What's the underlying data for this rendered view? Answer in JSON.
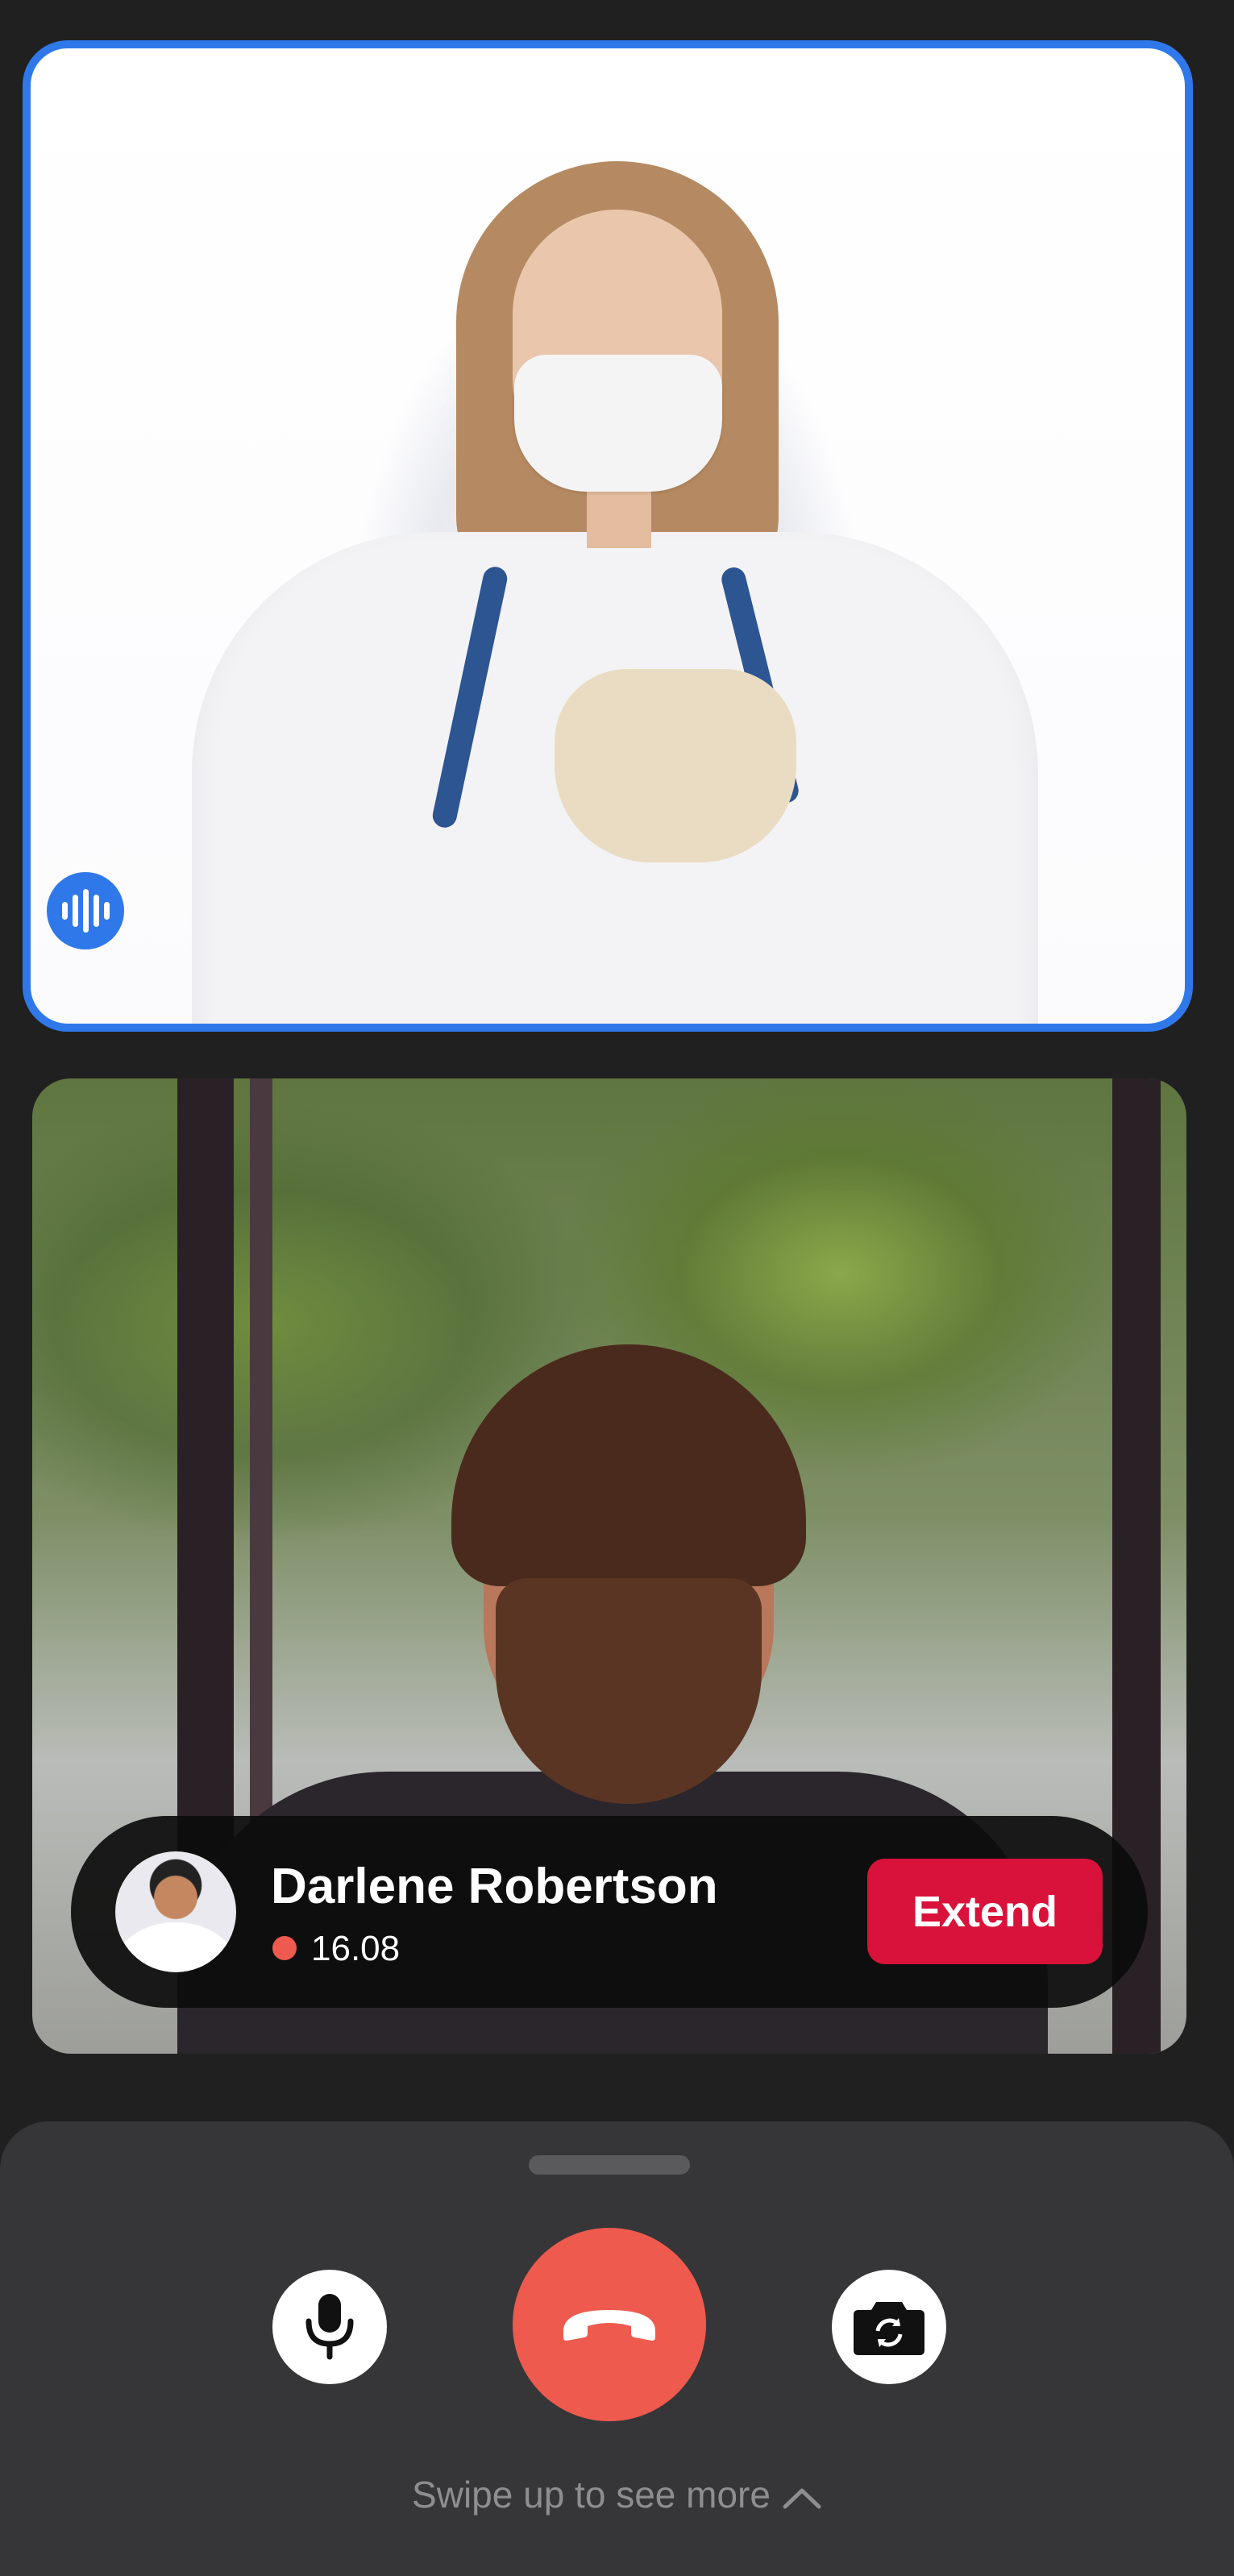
{
  "caller": {
    "name": "Darlene Robertson",
    "duration": "16.08"
  },
  "actions": {
    "extend_label": "Extend"
  },
  "sheet": {
    "swipe_hint": "Swipe up to see more"
  },
  "colors": {
    "active_speaker_border": "#2f78ea",
    "end_call": "#ef5a4e",
    "extend_button": "#d8123a",
    "recording_dot": "#ee5a4e"
  },
  "icons": {
    "voice_activity": "audio-wave-icon",
    "mic": "microphone-icon",
    "end_call": "phone-hangup-icon",
    "camera": "camera-switch-icon",
    "chevron": "chevron-up-icon"
  }
}
